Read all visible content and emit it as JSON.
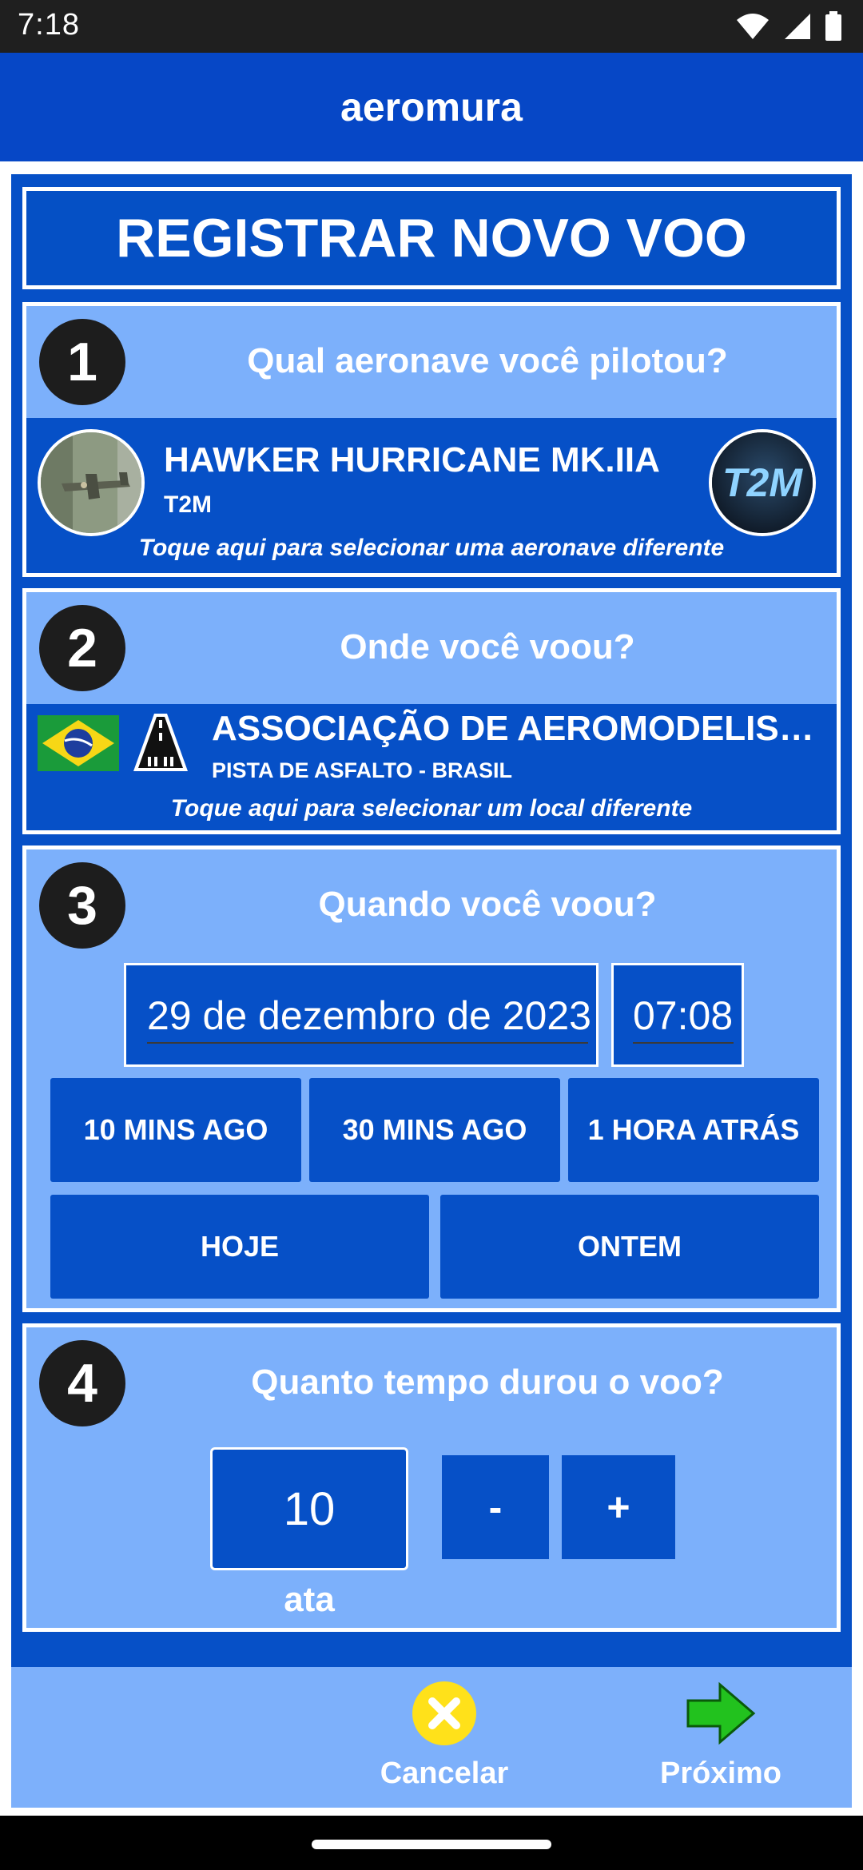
{
  "status_bar": {
    "time": "7:18"
  },
  "app": {
    "title": "aeromura"
  },
  "page": {
    "title": "REGISTRAR NOVO VOO"
  },
  "step1": {
    "number": "1",
    "question": "Qual aeronave você pilotou?",
    "aircraft_name": "HAWKER HURRICANE MK.IIA",
    "aircraft_brand": "T2M",
    "brand_logo_text": "T2M",
    "hint": "Toque aqui para selecionar uma aeronave diferente"
  },
  "step2": {
    "number": "2",
    "question": "Onde você voou?",
    "location_name": "ASSOCIAÇÃO DE AEROMODELISMO…",
    "location_sub": "PISTA DE ASFALTO - BRASIL",
    "hint": "Toque aqui para selecionar um local diferente"
  },
  "step3": {
    "number": "3",
    "question": "Quando você voou?",
    "date": "29 de dezembro de 2023",
    "time": "07:08",
    "quick_buttons": [
      "10 MINS AGO",
      "30 MINS AGO",
      "1 HORA ATRÁS",
      "HOJE",
      "ONTEM"
    ]
  },
  "step4": {
    "number": "4",
    "question": "Quanto tempo durou o voo?",
    "duration": "10",
    "minus": "-",
    "plus": "+",
    "unit": "ata"
  },
  "bottom": {
    "cancel": "Cancelar",
    "next": "Próximo"
  },
  "colors": {
    "primary_blue": "#0650c7",
    "light_blue": "#7cb0fb",
    "cancel_yellow": "#ffe11a",
    "next_green": "#22c21e"
  },
  "icons": [
    "wifi-icon",
    "signal-icon",
    "battery-icon",
    "brazil-flag-icon",
    "runway-icon",
    "cancel-icon",
    "next-arrow-icon"
  ]
}
